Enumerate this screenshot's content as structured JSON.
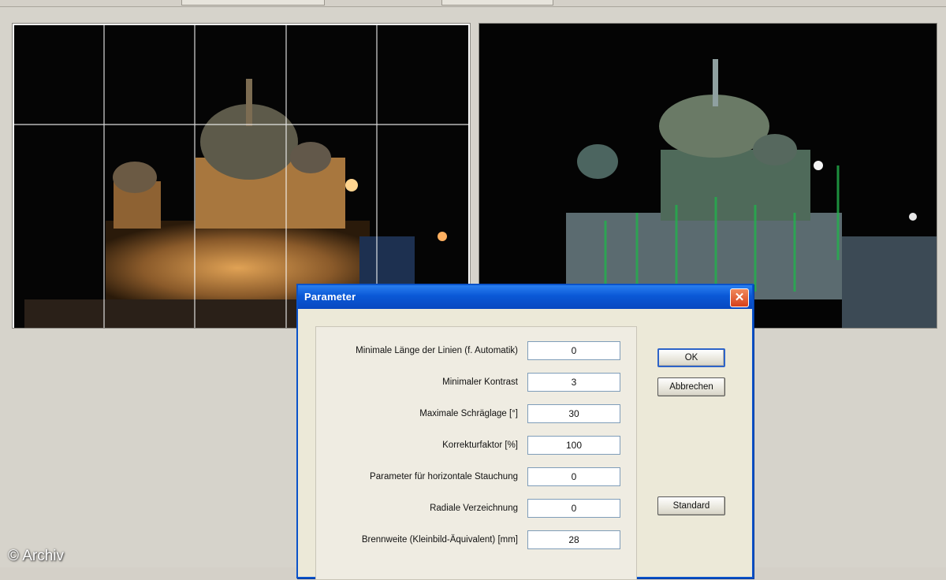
{
  "watermark": "© Archiv",
  "dialog": {
    "title": "Parameter",
    "close_symbol": "✕",
    "fields": [
      {
        "label": "Minimale Länge der Linien (f. Automatik)",
        "value": "0"
      },
      {
        "label": "Minimaler Kontrast",
        "value": "3"
      },
      {
        "label": "Maximale Schräglage [°]",
        "value": "30"
      },
      {
        "label": "Korrekturfaktor [%]",
        "value": "100"
      },
      {
        "label": "Parameter für horizontale Stauchung",
        "value": "0"
      },
      {
        "label": "Radiale Verzeichnung",
        "value": "0"
      },
      {
        "label": "Brennweite (Kleinbild-Äquivalent) [mm]",
        "value": "28"
      }
    ],
    "buttons": {
      "ok": "OK",
      "cancel": "Abbrechen",
      "standard": "Standard"
    }
  },
  "images": {
    "left": "Berlin cathedral night photo with grid overlay",
    "right": "Berlin cathedral edge-detected version"
  },
  "colors": {
    "titlebar": "#0a58d6",
    "accent": "#2d63c8"
  }
}
